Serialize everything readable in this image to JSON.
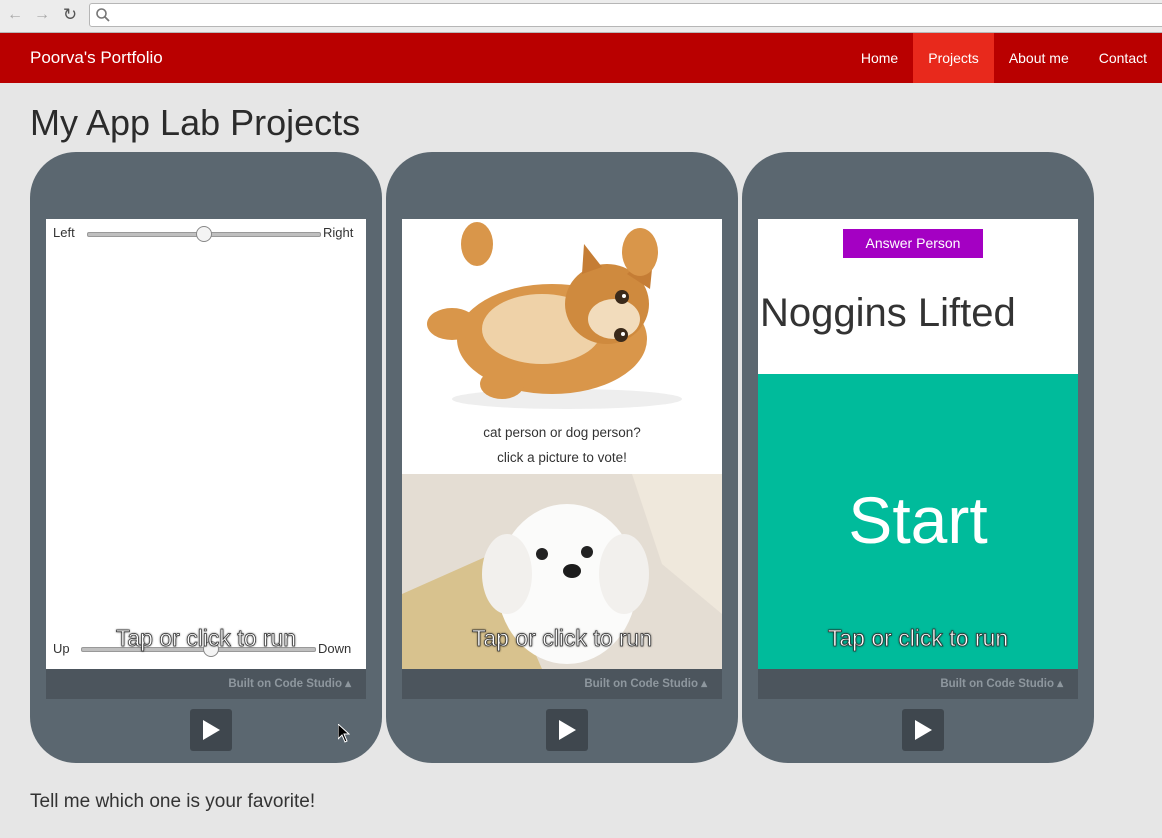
{
  "browser": {
    "url": "",
    "url_placeholder": ""
  },
  "navbar": {
    "brand": "Poorva's Portfolio",
    "links": [
      {
        "label": "Home"
      },
      {
        "label": "Projects",
        "active": true
      },
      {
        "label": "About me"
      },
      {
        "label": "Contact"
      }
    ],
    "color": "#b90000",
    "active_color": "#e8291c"
  },
  "page": {
    "title": "My App Lab Projects",
    "footer_text": "Tell me which one is your favorite!"
  },
  "apps": [
    {
      "slider_h": {
        "left_label": "Left",
        "right_label": "Right",
        "value": 0.5
      },
      "slider_v": {
        "left_label": "Up",
        "right_label": "Down",
        "value": 0.55
      },
      "run_text": "Tap or click to run",
      "built_on": "Built on Code Studio ▴"
    },
    {
      "question": "cat person or dog person?",
      "instruction": "click a picture to vote!",
      "run_text": "Tap or click to run",
      "built_on": "Built on Code Studio ▴"
    },
    {
      "button_label": "Answer Person",
      "heading": "Noggins Lifted",
      "start_label": "Start",
      "run_text": "Tap or click to run",
      "built_on": "Built on Code Studio ▴",
      "button_color": "#a400c3",
      "panel_color": "#00bb9b"
    }
  ]
}
